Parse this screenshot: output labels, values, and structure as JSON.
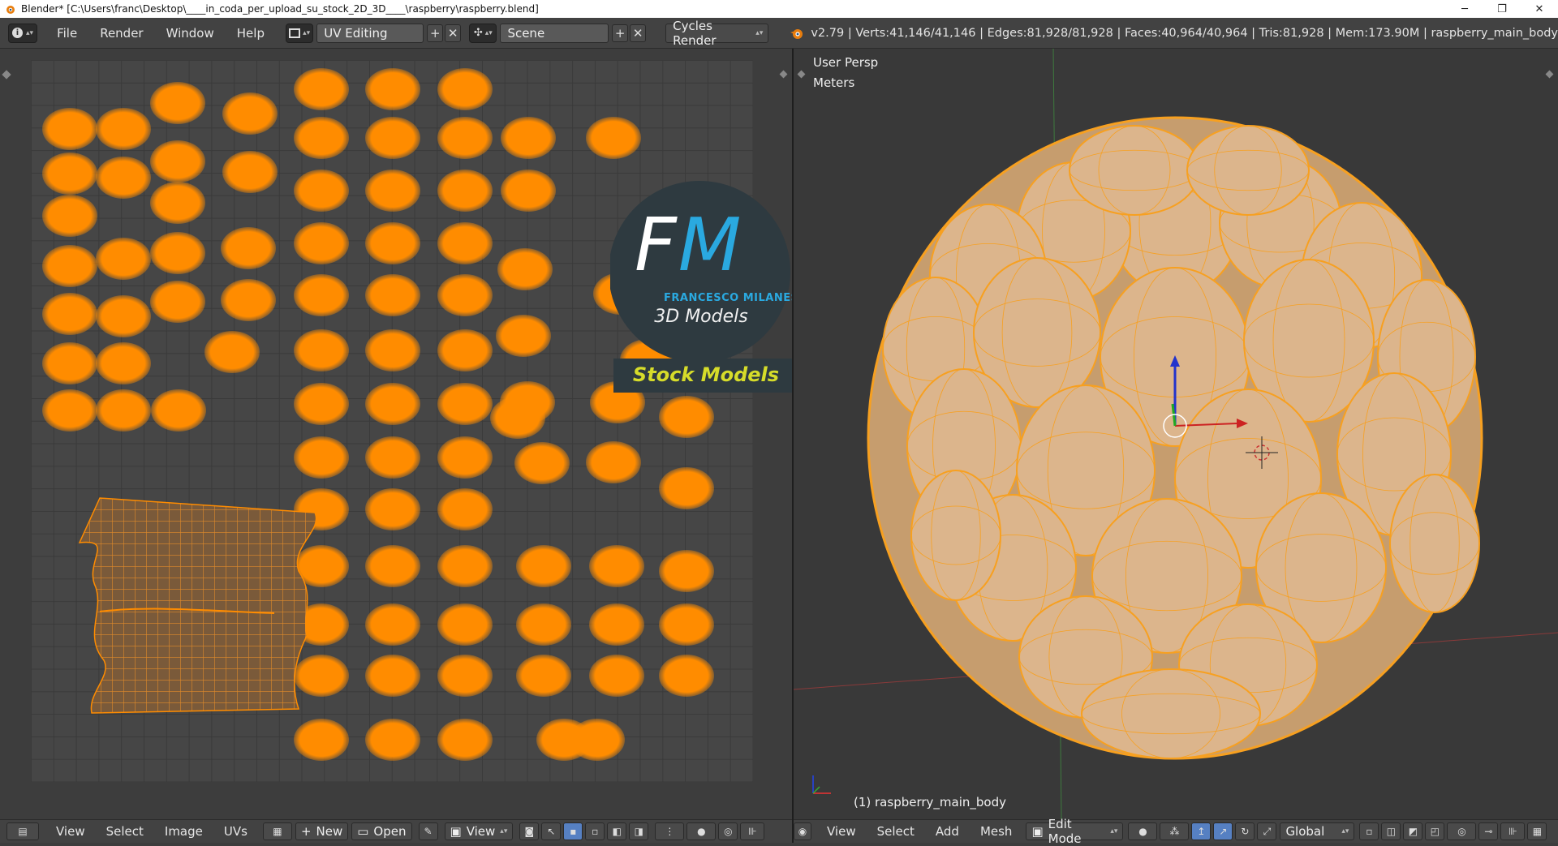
{
  "window": {
    "title": "Blender* [C:\\Users\\franc\\Desktop\\____in_coda_per_upload_su_stock_2D_3D____\\raspberry\\raspberry.blend]",
    "minimize": "─",
    "maximize": "❐",
    "close": "✕"
  },
  "header": {
    "menus": [
      "File",
      "Render",
      "Window",
      "Help"
    ],
    "layout": "UV Editing",
    "scene": "Scene",
    "engine": "Cycles Render",
    "stats": "v2.79 | Verts:41,146/41,146 | Edges:81,928/81,928 | Faces:40,964/40,964 | Tris:81,928 | Mem:173.90M | raspberry_main_body"
  },
  "watermark": {
    "initials": "FM",
    "name": "FRANCESCO MILANESE",
    "sub": "3D Models",
    "banner": "Stock Models"
  },
  "viewport": {
    "view_label": "User Persp",
    "units_label": "Meters",
    "object_label": "(1) raspberry_main_body"
  },
  "uv_footer": {
    "menus": [
      "View",
      "Select",
      "Image",
      "UVs"
    ],
    "new_label": "New",
    "open_label": "Open",
    "view_label": "View"
  },
  "vp_footer": {
    "menus": [
      "View",
      "Select",
      "Add",
      "Mesh"
    ],
    "mode": "Edit Mode",
    "orientation": "Global"
  },
  "colors": {
    "uv_island": "#ff8c00",
    "mesh_wire": "#f7a020",
    "fruit": "#d9b58a",
    "watermark_bg": "#2e3a40",
    "watermark_blue": "#2aa9e0",
    "banner_text": "#d6dc2a"
  }
}
